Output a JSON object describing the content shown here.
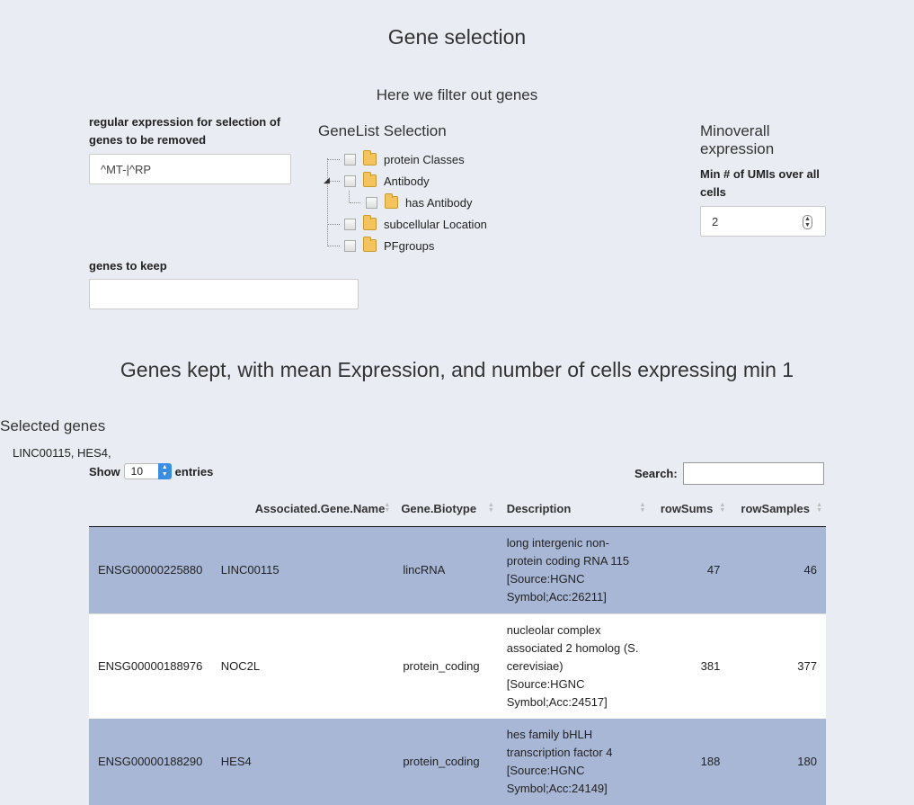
{
  "page": {
    "title": "Gene selection",
    "subtitle": "Here we filter out genes"
  },
  "regex": {
    "label": "regular expression for selection of genes to be removed",
    "value": "^MT-|^RP"
  },
  "keep": {
    "label": "genes to keep",
    "value": ""
  },
  "genelist": {
    "title": "GeneList Selection",
    "items": [
      {
        "label": "protein Classes"
      },
      {
        "label": "Antibody"
      },
      {
        "label": "has Antibody"
      },
      {
        "label": "subcellular Location"
      },
      {
        "label": "PFgroups"
      }
    ]
  },
  "minoverall": {
    "title": "Minoverall expression",
    "label": "Min # of UMIs over all cells",
    "value": "2"
  },
  "kept": {
    "title": "Genes kept, with mean Expression, and number of cells expressing min 1"
  },
  "selected": {
    "title": "Selected genes",
    "list": "LINC00115, HES4,"
  },
  "table": {
    "show_label": "Show",
    "entries_value": "10",
    "entries_label": "entries",
    "search_label": "Search:",
    "columns": [
      "",
      "Associated.Gene.Name",
      "Gene.Biotype",
      "Description",
      "rowSums",
      "rowSamples"
    ],
    "rows": [
      {
        "id": "ENSG00000225880",
        "name": "LINC00115",
        "biotype": "lincRNA",
        "description": "long intergenic non-protein coding RNA 115 [Source:HGNC Symbol;Acc:26211]",
        "rowSums": "47",
        "rowSamples": "46",
        "selected": true
      },
      {
        "id": "ENSG00000188976",
        "name": "NOC2L",
        "biotype": "protein_coding",
        "description": "nucleolar complex associated 2 homolog (S. cerevisiae) [Source:HGNC Symbol;Acc:24517]",
        "rowSums": "381",
        "rowSamples": "377",
        "selected": false
      },
      {
        "id": "ENSG00000188290",
        "name": "HES4",
        "biotype": "protein_coding",
        "description": "hes family bHLH transcription factor 4 [Source:HGNC Symbol;Acc:24149]",
        "rowSums": "188",
        "rowSamples": "180",
        "selected": true
      }
    ]
  },
  "colors": {
    "background": "#e9edf3",
    "selected_row": "#a9b7d6",
    "select_button": "#3a8de0"
  }
}
